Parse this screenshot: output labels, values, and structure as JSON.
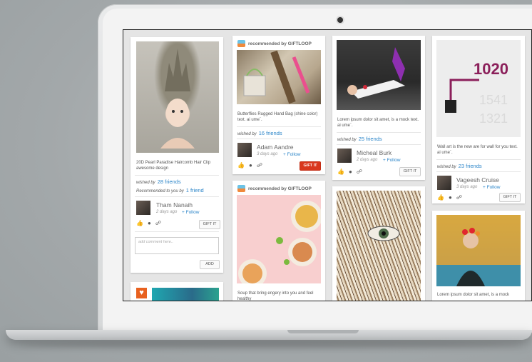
{
  "cards": [
    {
      "caption": "20D Pearl Paradise Haircomb Hair Clip awesome design",
      "wished_prefix": "wished by",
      "wished_count": "28 friends",
      "recommended_prefix": "Recommended to you by",
      "recommended_count": "1 friend",
      "user": "Tham Nanaih",
      "days": "2 days ago",
      "follow": "+ Follow",
      "gift": "GIFT IT",
      "comment_placeholder": "add comment here..",
      "add": "ADD"
    },
    {
      "recommended": "recommended by GIFTLOOP",
      "caption": "Butterflies Rugged Hand Bag (shine color) text. ai ume`.",
      "wished_prefix": "wished by",
      "wished_count": "16 friends",
      "user": "Adam Aandre",
      "days": "3 days ago",
      "follow": "+ Follow",
      "gift": "GIFT IT"
    },
    {
      "caption": "Lorem ipsum dolor sit amet, is a mock text. ai ume`.",
      "wished_prefix": "wished by",
      "wished_count": "25 friends",
      "user": "Micheal Burk",
      "days": "2 days ago",
      "follow": "+ Follow",
      "gift": "GIFT IT"
    },
    {
      "caption": "Wall art is the new are for wall for you text. ai ume`.",
      "wished_prefix": "wished by",
      "wished_count": "23 friends",
      "user": "Vageesh Cruise",
      "days": "3 days ago",
      "follow": "+ Follow",
      "gift": "GIFT IT"
    },
    {
      "recommended": "recommended by GIFTLOOP",
      "caption": "Soup that bring engery into you and feel healthy"
    },
    {
      "caption": "Lorem ipsum dolor sit amet, is a mock"
    }
  ],
  "colors": {
    "accent_orange": "#e8611f",
    "link_blue": "#2a84c8",
    "gift_red": "#d9371d"
  },
  "icons": [
    "heart-icon",
    "like-icon",
    "comment-icon",
    "share-icon",
    "giftloop-icon"
  ]
}
